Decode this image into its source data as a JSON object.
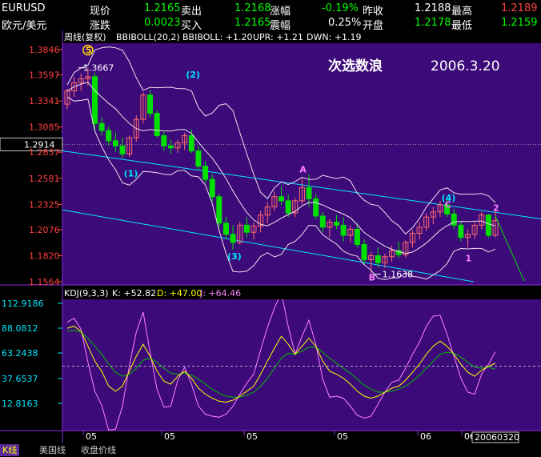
{
  "quote": {
    "symbol": "EURUSD",
    "name": "欧元/美元",
    "row1": [
      {
        "label": "现价",
        "value": "1.2165",
        "cls": "grn"
      },
      {
        "label": "卖出",
        "value": "1.2168",
        "cls": "grn"
      },
      {
        "label": "涨幅",
        "value": "-0.19%",
        "cls": "grn"
      },
      {
        "label": "昨收",
        "value": "1.2188",
        "cls": "wht"
      },
      {
        "label": "最高",
        "value": "1.2189",
        "cls": "red"
      }
    ],
    "row2": [
      {
        "label": "涨跌",
        "value": "0.0023",
        "cls": "grn"
      },
      {
        "label": "买入",
        "value": "1.2165",
        "cls": "grn"
      },
      {
        "label": "震幅",
        "value": "0.25%",
        "cls": "wht"
      },
      {
        "label": "开盘",
        "value": "1.2178",
        "cls": "grn"
      },
      {
        "label": "最低",
        "value": "1.2159",
        "cls": "grn"
      }
    ]
  },
  "main_panel": {
    "indicator_title": "周线(复权)",
    "indicator_name": "BBIBOLL(20,2)",
    "bbiboll": "BBIBOLL: +1.20",
    "upr": "UPR: +1.21",
    "dwn": "DWN: +1.19",
    "annotation_title": "次选数浪",
    "annotation_date": "2006.3.20",
    "price_axis": [
      "1.3846",
      "1.3597",
      "1.3341",
      "1.3085",
      "1.2914",
      "1.2837",
      "1.2581",
      "1.2325",
      "1.2076",
      "1.1820",
      "1.1564"
    ],
    "cursor_price": "1.2914",
    "high_label": "1.3667",
    "low_label": "1.1638",
    "wave_labels": [
      "5",
      "(2)",
      "(1)",
      "A",
      "(4)",
      "C",
      "2",
      "(3)",
      "B",
      "1"
    ]
  },
  "kdj_panel": {
    "indicator_name": "KDJ(9,3,3)",
    "k_label": "K: +52.82",
    "d_label": "D: +47.00",
    "j_label": "J: +64.46",
    "axis": [
      "112.9186",
      "88.0812",
      "63.2438",
      "37.6537",
      "12.8163"
    ]
  },
  "time_axis": {
    "labels": [
      "05",
      "05",
      "05",
      "05",
      "06",
      "06"
    ],
    "cursor_date": "20060320"
  },
  "tabs": [
    {
      "label": "K线",
      "active": true
    },
    {
      "label": "美国线",
      "active": false
    },
    {
      "label": "收盘价线",
      "active": false
    }
  ],
  "colors": {
    "panel_bg": "#3d0a7a",
    "grid": "#8a2be2",
    "up": "#ff6a6a",
    "down": "#00e000",
    "band": "#f0e0f0",
    "channel": "#00e5ff",
    "k": "#ffffff",
    "d": "#ffff00",
    "j": "#00c000",
    "j_line": "#ff80ff"
  },
  "chart_data": {
    "type": "candlestick",
    "series": [
      {
        "name": "BBIBOLL",
        "values": [
          1.2
        ]
      },
      {
        "name": "UPR",
        "values": [
          1.21
        ]
      },
      {
        "name": "DWN",
        "values": [
          1.19
        ]
      }
    ],
    "ohlc": [
      [
        1.331,
        1.346,
        1.326,
        1.344
      ],
      [
        1.344,
        1.358,
        1.338,
        1.352
      ],
      [
        1.352,
        1.361,
        1.344,
        1.356
      ],
      [
        1.356,
        1.367,
        1.349,
        1.358
      ],
      [
        1.358,
        1.362,
        1.305,
        1.312
      ],
      [
        1.312,
        1.318,
        1.3,
        1.305
      ],
      [
        1.305,
        1.309,
        1.29,
        1.295
      ],
      [
        1.295,
        1.303,
        1.284,
        1.29
      ],
      [
        1.29,
        1.298,
        1.278,
        1.282
      ],
      [
        1.282,
        1.3,
        1.279,
        1.298
      ],
      [
        1.298,
        1.32,
        1.294,
        1.316
      ],
      [
        1.316,
        1.343,
        1.312,
        1.34
      ],
      [
        1.34,
        1.345,
        1.318,
        1.322
      ],
      [
        1.322,
        1.325,
        1.298,
        1.3
      ],
      [
        1.3,
        1.304,
        1.285,
        1.29
      ],
      [
        1.29,
        1.296,
        1.282,
        1.288
      ],
      [
        1.288,
        1.296,
        1.283,
        1.293
      ],
      [
        1.293,
        1.303,
        1.286,
        1.3
      ],
      [
        1.3,
        1.306,
        1.283,
        1.285
      ],
      [
        1.285,
        1.29,
        1.266,
        1.27
      ],
      [
        1.27,
        1.275,
        1.253,
        1.257
      ],
      [
        1.257,
        1.262,
        1.235,
        1.24
      ],
      [
        1.24,
        1.243,
        1.21,
        1.214
      ],
      [
        1.214,
        1.22,
        1.198,
        1.203
      ],
      [
        1.203,
        1.212,
        1.188,
        1.195
      ],
      [
        1.195,
        1.215,
        1.193,
        1.212
      ],
      [
        1.212,
        1.22,
        1.2,
        1.205
      ],
      [
        1.205,
        1.215,
        1.198,
        1.211
      ],
      [
        1.211,
        1.226,
        1.205,
        1.222
      ],
      [
        1.222,
        1.235,
        1.214,
        1.23
      ],
      [
        1.23,
        1.245,
        1.226,
        1.24
      ],
      [
        1.24,
        1.25,
        1.232,
        1.236
      ],
      [
        1.236,
        1.242,
        1.22,
        1.224
      ],
      [
        1.224,
        1.239,
        1.22,
        1.236
      ],
      [
        1.236,
        1.258,
        1.232,
        1.249
      ],
      [
        1.249,
        1.262,
        1.23,
        1.238
      ],
      [
        1.238,
        1.243,
        1.218,
        1.221
      ],
      [
        1.221,
        1.225,
        1.205,
        1.21
      ],
      [
        1.21,
        1.218,
        1.2,
        1.215
      ],
      [
        1.215,
        1.222,
        1.208,
        1.212
      ],
      [
        1.212,
        1.22,
        1.196,
        1.202
      ],
      [
        1.202,
        1.212,
        1.195,
        1.208
      ],
      [
        1.208,
        1.214,
        1.19,
        1.193
      ],
      [
        1.193,
        1.198,
        1.173,
        1.178
      ],
      [
        1.178,
        1.186,
        1.164,
        1.182
      ],
      [
        1.182,
        1.19,
        1.17,
        1.175
      ],
      [
        1.175,
        1.184,
        1.17,
        1.181
      ],
      [
        1.181,
        1.192,
        1.176,
        1.187
      ],
      [
        1.187,
        1.196,
        1.18,
        1.183
      ],
      [
        1.183,
        1.197,
        1.18,
        1.195
      ],
      [
        1.195,
        1.207,
        1.19,
        1.204
      ],
      [
        1.204,
        1.215,
        1.198,
        1.21
      ],
      [
        1.21,
        1.224,
        1.206,
        1.22
      ],
      [
        1.22,
        1.23,
        1.213,
        1.225
      ],
      [
        1.225,
        1.236,
        1.22,
        1.232
      ],
      [
        1.232,
        1.239,
        1.22,
        1.223
      ],
      [
        1.223,
        1.228,
        1.208,
        1.212
      ],
      [
        1.212,
        1.216,
        1.196,
        1.2
      ],
      [
        1.2,
        1.208,
        1.19,
        1.203
      ],
      [
        1.203,
        1.215,
        1.198,
        1.212
      ],
      [
        1.212,
        1.225,
        1.208,
        1.222
      ],
      [
        1.222,
        1.223,
        1.2,
        1.202
      ],
      [
        1.202,
        1.228,
        1.2,
        1.2165
      ]
    ],
    "kdj": {
      "k": [
        88,
        90,
        85,
        70,
        55,
        45,
        30,
        25,
        30,
        45,
        60,
        72,
        60,
        45,
        35,
        32,
        40,
        45,
        38,
        28,
        22,
        18,
        15,
        14,
        16,
        20,
        25,
        30,
        42,
        55,
        68,
        80,
        72,
        62,
        70,
        78,
        70,
        55,
        45,
        42,
        38,
        32,
        25,
        20,
        18,
        20,
        24,
        28,
        30,
        36,
        44,
        52,
        62,
        70,
        75,
        70,
        62,
        52,
        44,
        40,
        46,
        50,
        52.82
      ],
      "d": [
        85,
        86,
        84,
        78,
        70,
        62,
        52,
        44,
        40,
        42,
        48,
        56,
        58,
        54,
        48,
        43,
        42,
        43,
        41,
        37,
        32,
        27,
        23,
        20,
        19,
        19,
        21,
        24,
        30,
        38,
        48,
        58,
        63,
        62,
        65,
        69,
        69,
        64,
        58,
        53,
        48,
        43,
        37,
        31,
        27,
        24,
        24,
        25,
        27,
        30,
        35,
        41,
        48,
        55,
        62,
        64,
        63,
        59,
        54,
        49,
        48,
        49,
        47.0
      ],
      "j": [
        94,
        98,
        87,
        54,
        25,
        11,
        -14,
        -13,
        10,
        51,
        84,
        104,
        64,
        27,
        9,
        10,
        36,
        49,
        32,
        10,
        2,
        0,
        -1,
        2,
        10,
        22,
        33,
        42,
        66,
        89,
        108,
        124,
        90,
        62,
        80,
        96,
        72,
        37,
        19,
        20,
        18,
        10,
        1,
        -2,
        0,
        12,
        24,
        34,
        36,
        48,
        62,
        74,
        90,
        100,
        101,
        82,
        60,
        38,
        24,
        22,
        42,
        52,
        64.46
      ]
    }
  }
}
